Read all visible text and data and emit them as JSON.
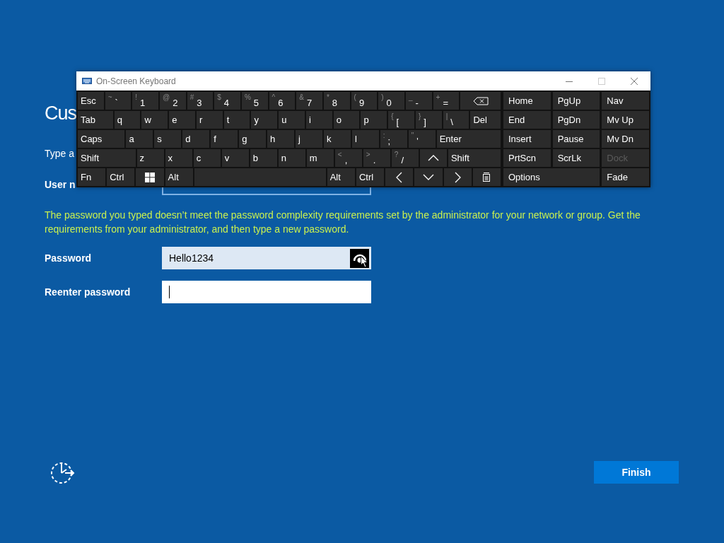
{
  "setup": {
    "heading": "Cus",
    "instruction": "Type a",
    "username_label": "User n",
    "message": "The password you typed doesn’t meet the password complexity requirements set by the administrator for your network or group. Get the requirements from your administrator, and then type a new password.",
    "password": {
      "label": "Password",
      "value": "Hello1234"
    },
    "reenter": {
      "label": "Reenter password",
      "focused": true
    },
    "finish_button": "Finish"
  },
  "keyboard": {
    "title": "On-Screen Keyboard",
    "rows": [
      [
        {
          "kind": "key",
          "label": "Esc"
        },
        {
          "kind": "key",
          "shift": "~",
          "label": "`"
        },
        {
          "kind": "key",
          "shift": "!",
          "label": "1"
        },
        {
          "kind": "key",
          "shift": "@",
          "label": "2"
        },
        {
          "kind": "key",
          "shift": "#",
          "label": "3"
        },
        {
          "kind": "key",
          "shift": "$",
          "label": "4"
        },
        {
          "kind": "key",
          "shift": "%",
          "label": "5"
        },
        {
          "kind": "key",
          "shift": "^",
          "label": "6"
        },
        {
          "kind": "key",
          "shift": "&",
          "label": "7"
        },
        {
          "kind": "key",
          "shift": "*",
          "label": "8"
        },
        {
          "kind": "key",
          "shift": "(",
          "label": "9"
        },
        {
          "kind": "key",
          "shift": ")",
          "label": "0"
        },
        {
          "kind": "key",
          "shift": "_",
          "label": "-"
        },
        {
          "kind": "key",
          "shift": "+",
          "label": "="
        },
        {
          "kind": "backspace"
        }
      ],
      [
        {
          "kind": "key",
          "label": "Tab"
        },
        {
          "kind": "key",
          "label": "q"
        },
        {
          "kind": "key",
          "label": "w"
        },
        {
          "kind": "key",
          "label": "e"
        },
        {
          "kind": "key",
          "label": "r"
        },
        {
          "kind": "key",
          "label": "t"
        },
        {
          "kind": "key",
          "label": "y"
        },
        {
          "kind": "key",
          "label": "u"
        },
        {
          "kind": "key",
          "label": "i"
        },
        {
          "kind": "key",
          "label": "o"
        },
        {
          "kind": "key",
          "label": "p"
        },
        {
          "kind": "key",
          "shift": "{",
          "label": "["
        },
        {
          "kind": "key",
          "shift": "}",
          "label": "]"
        },
        {
          "kind": "key",
          "shift": "|",
          "label": "\\"
        },
        {
          "kind": "key",
          "label": "Del"
        }
      ],
      [
        {
          "kind": "key",
          "label": "Caps"
        },
        {
          "kind": "key",
          "label": "a"
        },
        {
          "kind": "key",
          "label": "s"
        },
        {
          "kind": "key",
          "label": "d"
        },
        {
          "kind": "key",
          "label": "f"
        },
        {
          "kind": "key",
          "label": "g"
        },
        {
          "kind": "key",
          "label": "h"
        },
        {
          "kind": "key",
          "label": "j"
        },
        {
          "kind": "key",
          "label": "k"
        },
        {
          "kind": "key",
          "label": "l"
        },
        {
          "kind": "key",
          "shift": ":",
          "label": ";"
        },
        {
          "kind": "key",
          "shift": "\"",
          "label": "'"
        },
        {
          "kind": "key",
          "label": "Enter"
        }
      ],
      [
        {
          "kind": "key",
          "label": "Shift"
        },
        {
          "kind": "key",
          "label": "z"
        },
        {
          "kind": "key",
          "label": "x"
        },
        {
          "kind": "key",
          "label": "c"
        },
        {
          "kind": "key",
          "label": "v"
        },
        {
          "kind": "key",
          "label": "b"
        },
        {
          "kind": "key",
          "label": "n"
        },
        {
          "kind": "key",
          "label": "m"
        },
        {
          "kind": "key",
          "shift": "<",
          "label": ","
        },
        {
          "kind": "key",
          "shift": ">",
          "label": "."
        },
        {
          "kind": "key",
          "shift": "?",
          "label": "/"
        },
        {
          "kind": "up"
        },
        {
          "kind": "key",
          "label": "Shift"
        }
      ],
      [
        {
          "kind": "key",
          "label": "Fn"
        },
        {
          "kind": "key",
          "label": "Ctrl"
        },
        {
          "kind": "windows"
        },
        {
          "kind": "key",
          "label": "Alt"
        },
        {
          "kind": "space"
        },
        {
          "kind": "key",
          "label": "Alt"
        },
        {
          "kind": "key",
          "label": "Ctrl"
        },
        {
          "kind": "left"
        },
        {
          "kind": "down"
        },
        {
          "kind": "right"
        },
        {
          "kind": "menu"
        }
      ]
    ],
    "nav": [
      [
        {
          "label": "Home",
          "disabled": false
        },
        {
          "label": "PgUp",
          "disabled": false
        },
        {
          "label": "Nav",
          "disabled": false
        }
      ],
      [
        {
          "label": "End",
          "disabled": false
        },
        {
          "label": "PgDn",
          "disabled": false
        },
        {
          "label": "Mv Up",
          "disabled": false
        }
      ],
      [
        {
          "label": "Insert",
          "disabled": false
        },
        {
          "label": "Pause",
          "disabled": false
        },
        {
          "label": "Mv Dn",
          "disabled": false
        }
      ],
      [
        {
          "label": "PrtScn",
          "disabled": false
        },
        {
          "label": "ScrLk",
          "disabled": false
        },
        {
          "label": "Dock",
          "disabled": true
        }
      ],
      [
        {
          "label": "Options",
          "disabled": false
        },
        {
          "label": "Fade",
          "disabled": false
        }
      ]
    ]
  }
}
